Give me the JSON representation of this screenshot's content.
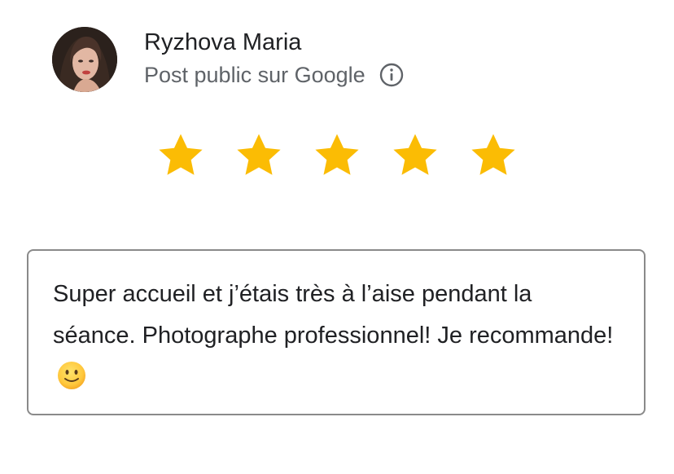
{
  "review": {
    "author_name": "Ryzhova Maria",
    "visibility_note": "Post public sur Google",
    "rating": 5,
    "rating_max": 5,
    "text": "Super accueil et j’étais très à l’aise pendant la séance. Photographe professionnel! Je recommande!",
    "emoji": "slightly-smiling-face-emoji"
  },
  "icons": {
    "info": "info-icon",
    "star": "star-icon"
  },
  "colors": {
    "star": "#FBBC04",
    "border": "#8A8A8A",
    "primary_text": "#202124",
    "secondary_text": "#5F6368"
  }
}
